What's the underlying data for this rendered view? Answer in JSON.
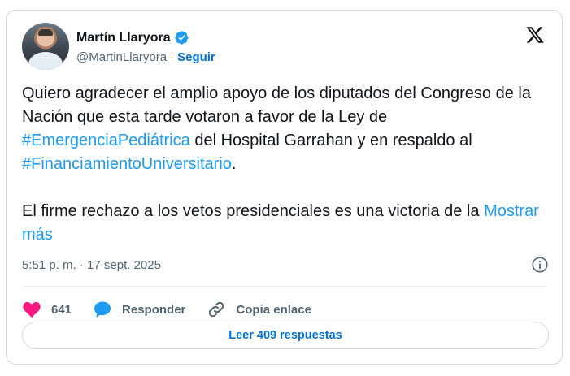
{
  "author": {
    "name": "Martín Llaryora",
    "handle": "@MartinLlaryora",
    "separator": "·",
    "follow_label": "Seguir"
  },
  "icons": {
    "verified": "verified-badge-icon",
    "brand": "x-logo-icon",
    "info": "info-icon",
    "like": "heart-icon",
    "reply": "speech-bubble-icon",
    "copy": "link-icon"
  },
  "tweet": {
    "p1_text_1": "Quiero agradecer el amplio apoyo de los diputados del Congreso de la Nación que esta tarde votaron a favor de la Ley de ",
    "p1_hashtag_1": "#EmergenciaPediátrica",
    "p1_text_2": " del Hospital Garrahan y en respaldo al ",
    "p1_hashtag_2": "#FinanciamientoUniversitario",
    "p1_text_3": ".",
    "p2_text": "El firme rechazo a los vetos presidenciales es una victoria de la ",
    "show_more_label": "Mostrar más",
    "timestamp": "5:51 p. m. · 17 sept. 2025"
  },
  "actions": {
    "like_count": "641",
    "reply_label": "Responder",
    "copy_label": "Copia enlace"
  },
  "footer": {
    "read_replies_label": "Leer 409 respuestas"
  },
  "colors": {
    "accent": "#1d9bf0",
    "follow": "#006fd6",
    "like": "#f91880",
    "muted": "#536471"
  }
}
